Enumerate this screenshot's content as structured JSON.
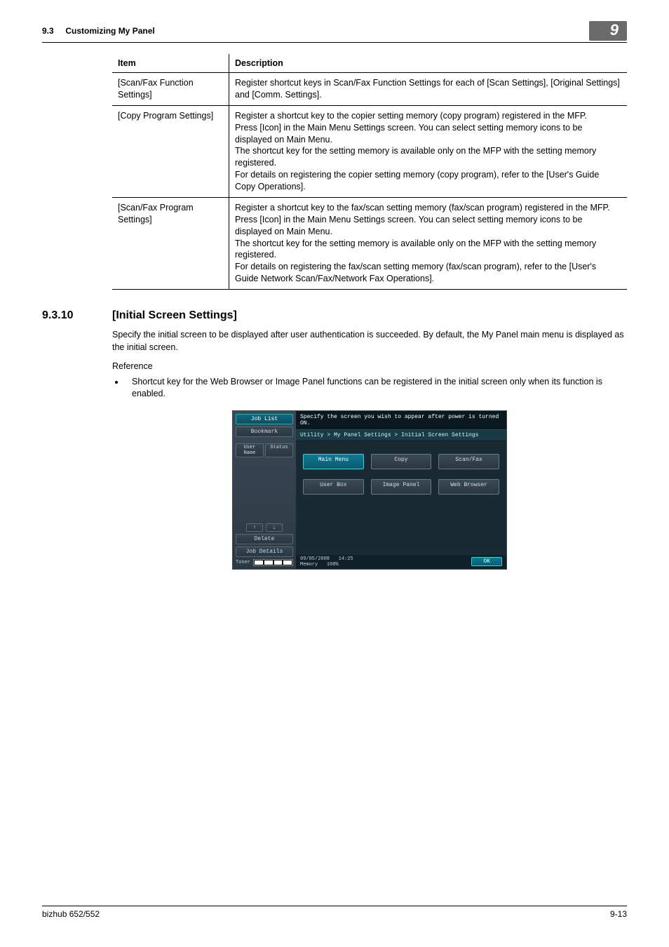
{
  "header": {
    "section_num": "9.3",
    "section_title": "Customizing My Panel",
    "chapter_badge": "9"
  },
  "table": {
    "headers": {
      "item": "Item",
      "desc": "Description"
    },
    "rows": [
      {
        "item": "[Scan/Fax Function Settings]",
        "desc": "Register shortcut keys in Scan/Fax Function Settings for each of [Scan Settings], [Original Settings] and [Comm. Settings]."
      },
      {
        "item": "[Copy Program Settings]",
        "desc": "Register a shortcut key to the copier setting memory (copy program) registered in the MFP.\nPress [Icon] in the Main Menu Settings screen. You can select setting memory icons to be displayed on Main Menu.\nThe shortcut key for the setting memory is available only on the MFP with the setting memory registered.\nFor details on registering the copier setting memory (copy program), refer to the [User's Guide Copy Operations]."
      },
      {
        "item": "[Scan/Fax Program Settings]",
        "desc": "Register a shortcut key to the fax/scan setting memory (fax/scan program) registered in the MFP.\nPress [Icon] in the Main Menu Settings screen. You can select setting memory icons to be displayed on Main Menu.\nThe shortcut key for the setting memory is available only on the MFP with the setting memory registered.\nFor details on registering the fax/scan setting memory (fax/scan program), refer to the [User's Guide Network Scan/Fax/Network Fax Operations]."
      }
    ]
  },
  "section": {
    "num": "9.3.10",
    "title": "[Initial Screen Settings]",
    "intro": "Specify the initial screen to be displayed after user authentication is succeeded. By default, the My Panel main menu is displayed as the initial screen.",
    "ref_label": "Reference",
    "bullets": [
      "Shortcut key for the Web Browser or Image Panel functions can be registered in the initial screen only when its function is enabled."
    ]
  },
  "panel": {
    "left": {
      "job_list": "Job List",
      "bookmark": "Bookmark",
      "user": "User Name",
      "status": "Status",
      "arrow_up": "↑",
      "arrow_down": "↓",
      "delete": "Delete",
      "job_details": "Job Details",
      "toner_label": "Toner"
    },
    "right": {
      "instr": "Specify the screen you wish to appear after power is turned ON.",
      "breadcrumb": "Utility > My Panel Settings > Initial Screen Settings",
      "options": [
        "Main Menu",
        "Copy",
        "Scan/Fax",
        "User Box",
        "Image Panel",
        "Web Browser"
      ],
      "date": "09/05/2008",
      "time": "14:25",
      "mem_label": "Memory",
      "mem_val": "100%",
      "ok": "OK"
    }
  },
  "footer": {
    "model": "bizhub 652/552",
    "page": "9-13"
  }
}
